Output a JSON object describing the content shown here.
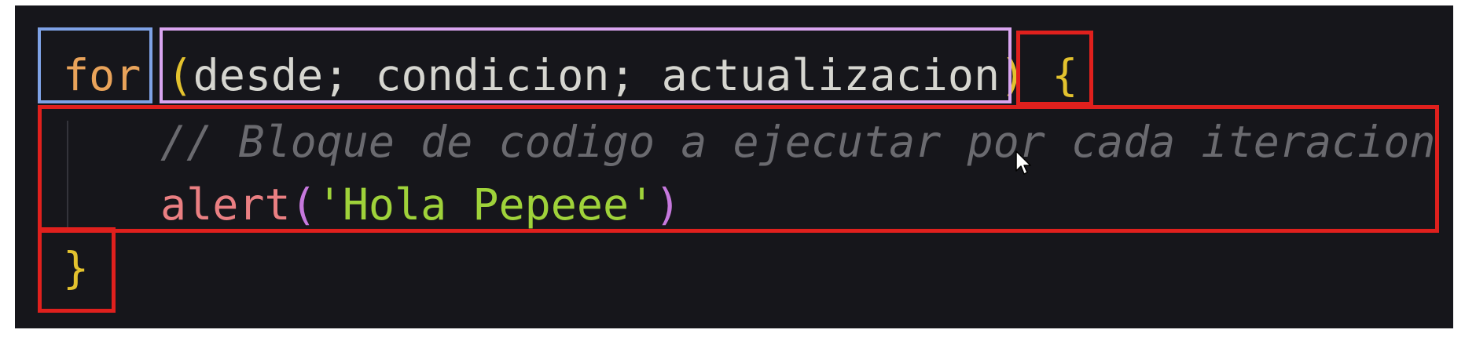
{
  "code": {
    "line1": {
      "keyword": "for",
      "space": " ",
      "open_paren": "(",
      "init": "desde",
      "sep1": "; ",
      "condition": "condicion",
      "sep2": "; ",
      "update": "actualizacion",
      "close_paren": ")",
      "space2": " ",
      "open_brace": "{"
    },
    "line2": {
      "comment": "// Bloque de codigo a ejecutar por cada iteracion"
    },
    "line3": {
      "function": "alert",
      "open_paren": "(",
      "string": "'Hola Pepeee'",
      "close_paren": ")"
    },
    "line4": {
      "close_brace": "}"
    }
  },
  "colors": {
    "editor_background": "#16161b",
    "keyword": "#e9a35a",
    "bracket_yellow": "#e3c22e",
    "bracket_purple": "#c678dd",
    "identifier": "#d6d6d0",
    "comment": "#6a6a6f",
    "function": "#ea7f82",
    "string": "#9fd23a",
    "highlight_blue": "#7ea2e6",
    "highlight_purple": "#d9a5f0",
    "highlight_red": "#e0201d"
  },
  "icons": {
    "cursor": "mouse-pointer-icon"
  }
}
